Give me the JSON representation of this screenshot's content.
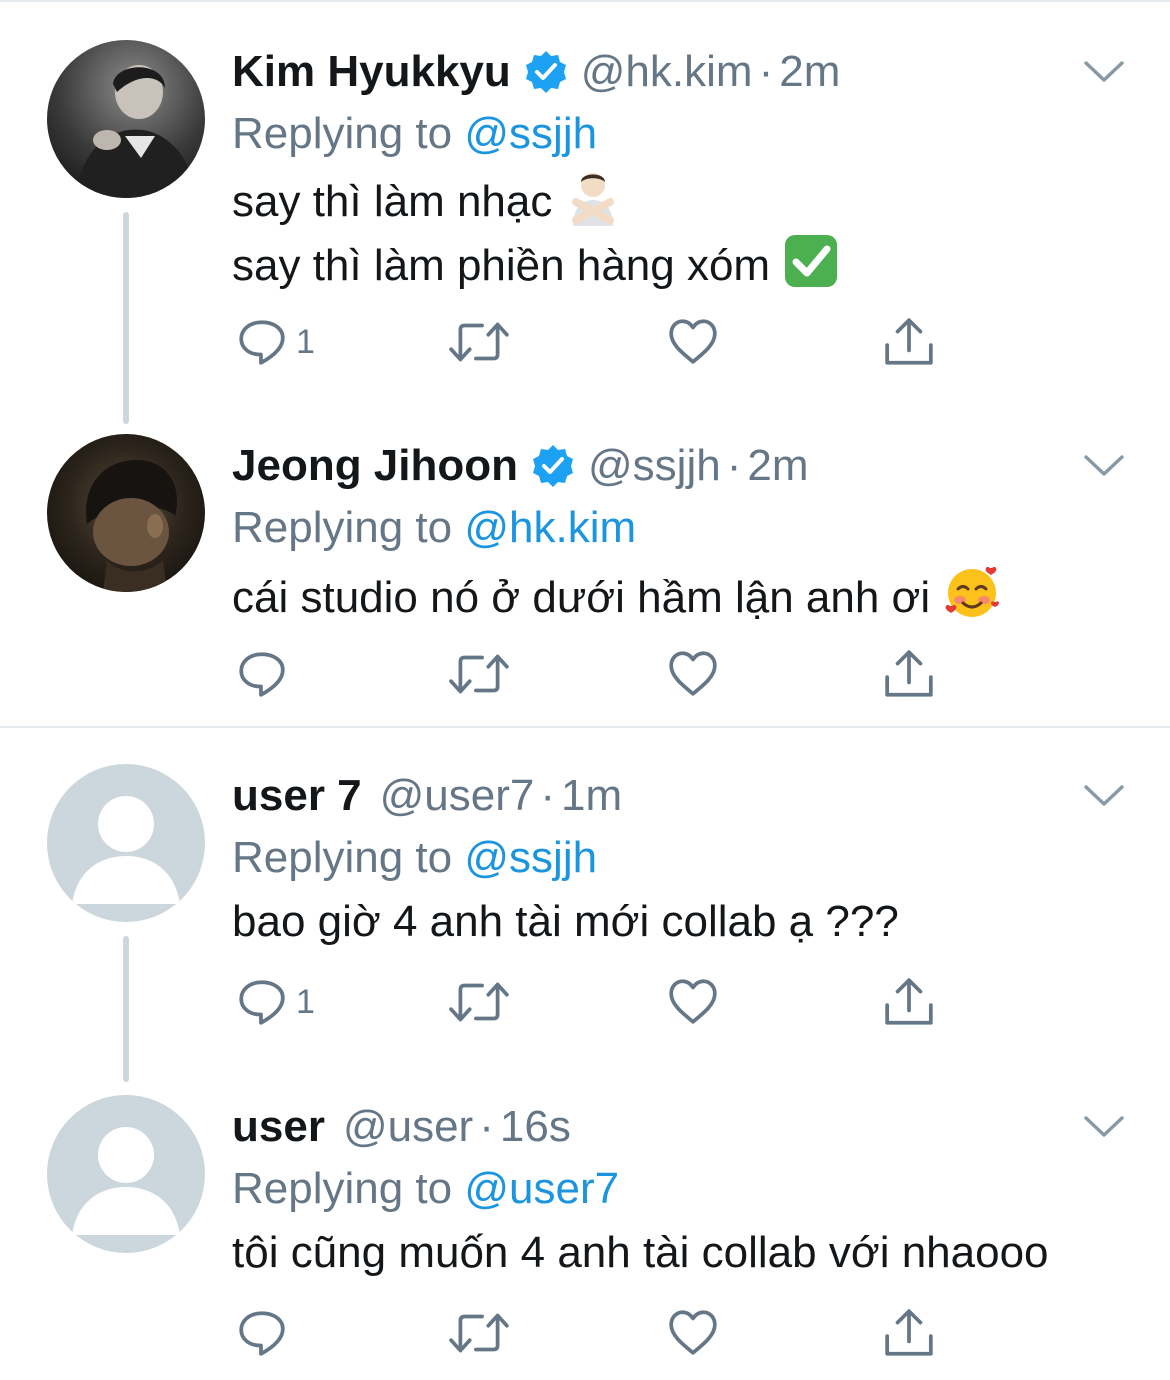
{
  "tweets": [
    {
      "name": "Kim Hyukkyu",
      "verified": true,
      "handle": "@hk.kim",
      "separator": "·",
      "time": "2m",
      "replying_prefix": "Replying to",
      "replying_to": "@ssjjh",
      "lines": [
        "say thì làm nhạc",
        "say thì làm phiền hàng xóm"
      ],
      "emoji_names": [
        "person-gesturing-no-emoji",
        "check-mark-button-emoji"
      ],
      "reply_count": "1"
    },
    {
      "name": "Jeong Jihoon",
      "verified": true,
      "handle": "@ssjjh",
      "separator": "·",
      "time": "2m",
      "replying_prefix": "Replying to",
      "replying_to": "@hk.kim",
      "lines": [
        "cái studio nó ở dưới hầm lận anh ơi"
      ],
      "emoji_names": [
        "smiling-face-with-hearts-emoji"
      ],
      "reply_count": ""
    },
    {
      "name": "user 7",
      "verified": false,
      "handle": "@user7",
      "separator": "·",
      "time": "1m",
      "replying_prefix": "Replying to",
      "replying_to": "@ssjjh",
      "lines": [
        "bao giờ 4 anh tài mới collab ạ ???"
      ],
      "emoji_names": [],
      "reply_count": "1"
    },
    {
      "name": "user",
      "verified": false,
      "handle": "@user",
      "separator": "·",
      "time": "16s",
      "replying_prefix": "Replying to",
      "replying_to": "@user7",
      "lines": [
        "tôi cũng muốn 4 anh tài collab với nhaooo"
      ],
      "emoji_names": [],
      "reply_count": ""
    }
  ],
  "icons": {
    "reply": "reply-icon",
    "retweet": "retweet-icon",
    "like": "heart-icon",
    "share": "share-icon",
    "more": "chevron-down-icon",
    "verified": "verified-badge-icon",
    "default_avatar": "default-avatar-icon"
  },
  "colors": {
    "text": "#14171a",
    "secondary": "#657786",
    "link": "#1b95e0",
    "verified": "#1da1f2",
    "divider": "#e6ecf0",
    "thread_line": "#ccd6dd",
    "default_avatar_bg": "#ccd6dd"
  }
}
